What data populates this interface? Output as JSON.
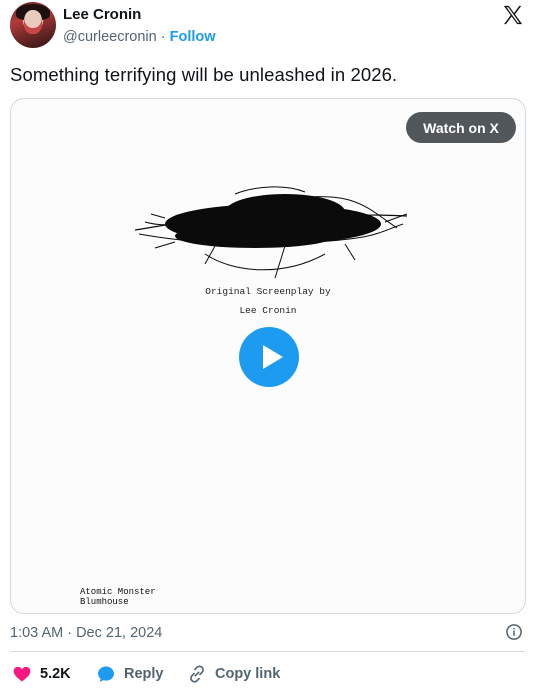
{
  "author": {
    "name": "Lee Cronin",
    "handle": "@curleecronin",
    "separator": " · ",
    "follow_label": "Follow"
  },
  "tweet": {
    "text": "Something terrifying will be unleashed in 2026.",
    "timestamp": "1:03 AM · Dec 21, 2024"
  },
  "media": {
    "watch_label": "Watch on X",
    "credit_line1": "Original Screenplay by",
    "credit_line2": "Lee Cronin",
    "studio_line1": "Atomic Monster",
    "studio_line2": "Blumhouse"
  },
  "actions": {
    "like_count": "5.2K",
    "reply_label": "Reply",
    "copy_label": "Copy link"
  },
  "colors": {
    "accent": "#1d9bf0",
    "like": "#f91880",
    "muted": "#536471"
  },
  "icons": [
    "x-logo-icon",
    "play-icon",
    "info-icon",
    "heart-icon",
    "reply-bubble-icon",
    "link-icon"
  ]
}
